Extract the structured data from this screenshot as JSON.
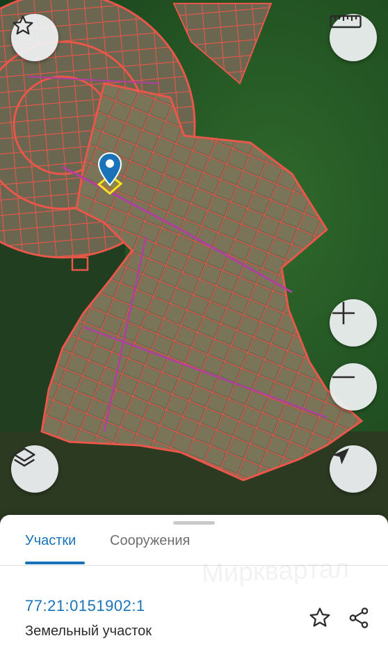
{
  "map": {
    "buttons": {
      "favorite": "favorite",
      "ruler": "ruler",
      "zoom_in": "zoom-in",
      "zoom_out": "zoom-out",
      "layers": "layers",
      "locate": "locate"
    },
    "colors": {
      "forest": "#1f4d22",
      "parcel_outline": "#e8574a",
      "road": "#b03fa0",
      "selected": "#f5e61a",
      "pin": "#1a73b8"
    }
  },
  "sheet": {
    "tabs": [
      {
        "label": "Участки",
        "active": true
      },
      {
        "label": "Сооружения",
        "active": false
      }
    ],
    "watermark": "Мирквартал",
    "result": {
      "cadastral_number": "77:21:0151902:1",
      "type": "Земельный участок"
    }
  }
}
